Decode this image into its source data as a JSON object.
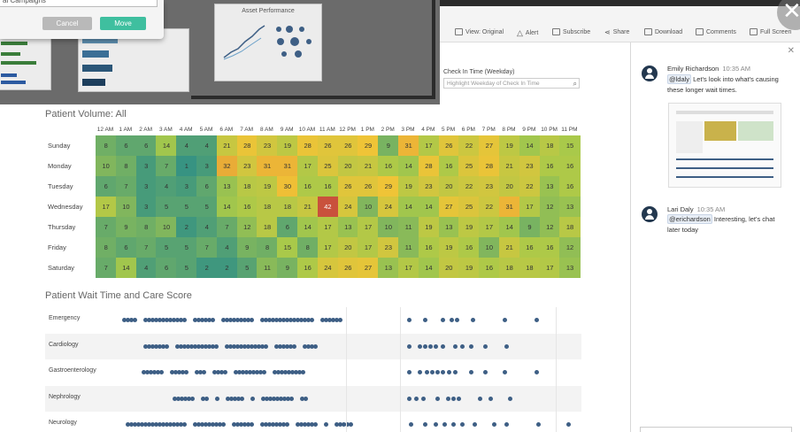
{
  "dialog": {
    "campaign_text": "al Campaigns",
    "cancel_label": "Cancel",
    "move_label": "Move"
  },
  "thumb": {
    "asset_title": "Asset Performance"
  },
  "toolbar": {
    "view_original": "View: Original",
    "alert": "Alert",
    "subscribe": "Subscribe",
    "share": "Share",
    "download": "Download",
    "comments": "Comments",
    "full_screen": "Full Screen"
  },
  "filter": {
    "label": "Check In Time (Weekday)",
    "placeholder": "Highlight Weekday of Check In Time"
  },
  "heatmap": {
    "title": "Patient Volume: All",
    "hours": [
      "12 AM",
      "1 AM",
      "2 AM",
      "3 AM",
      "4 AM",
      "5 AM",
      "6 AM",
      "7 AM",
      "8 AM",
      "9 AM",
      "10 AM",
      "11 AM",
      "12 PM",
      "1 PM",
      "2 PM",
      "3 PM",
      "4 PM",
      "5 PM",
      "6 PM",
      "7 PM",
      "8 PM",
      "9 PM",
      "10 PM",
      "11 PM"
    ],
    "days": [
      "Sunday",
      "Monday",
      "Tuesday",
      "Wednesday",
      "Thursday",
      "Friday",
      "Saturday"
    ],
    "values": [
      [
        8,
        6,
        6,
        14,
        4,
        4,
        21,
        28,
        23,
        19,
        28,
        26,
        26,
        29,
        9,
        31,
        17,
        26,
        22,
        27,
        19,
        14,
        18,
        15
      ],
      [
        10,
        8,
        3,
        7,
        1,
        3,
        32,
        23,
        31,
        31,
        17,
        25,
        20,
        21,
        16,
        14,
        28,
        16,
        25,
        28,
        21,
        23,
        16,
        16
      ],
      [
        6,
        7,
        3,
        4,
        3,
        6,
        13,
        18,
        19,
        30,
        16,
        16,
        26,
        26,
        29,
        19,
        23,
        20,
        22,
        23,
        20,
        22,
        13,
        16
      ],
      [
        17,
        10,
        3,
        5,
        5,
        5,
        14,
        16,
        18,
        18,
        21,
        42,
        24,
        10,
        24,
        14,
        14,
        27,
        25,
        22,
        31,
        17,
        12,
        13
      ],
      [
        7,
        9,
        8,
        10,
        2,
        4,
        7,
        12,
        18,
        6,
        14,
        17,
        13,
        17,
        10,
        11,
        19,
        13,
        19,
        17,
        14,
        9,
        12,
        18
      ],
      [
        8,
        6,
        7,
        5,
        5,
        7,
        4,
        9,
        8,
        15,
        8,
        17,
        20,
        17,
        23,
        11,
        16,
        19,
        16,
        10,
        21,
        16,
        16,
        12
      ],
      [
        7,
        14,
        4,
        6,
        5,
        2,
        2,
        5,
        11,
        9,
        16,
        24,
        26,
        27,
        13,
        17,
        14,
        20,
        19,
        16,
        18,
        18,
        17,
        13
      ]
    ]
  },
  "wait": {
    "title": "Patient Wait Time and Care Score",
    "departments": [
      "Emergency",
      "Cardiology",
      "Gastroenterology",
      "Nephrology",
      "Neurology"
    ]
  },
  "comments": [
    {
      "author": "Emily Richardson",
      "time": "10:35 AM",
      "mention": "@ldaly",
      "text_a": " Let's look into what's causing",
      "text_b": "these longer wait times."
    },
    {
      "author": "Lari Daly",
      "time": "10:35 AM",
      "mention": "@erichardson",
      "text_a": " Interesting, let's chat",
      "text_b": "later today"
    }
  ],
  "colors": {
    "low": "#2f8f86",
    "mid": "#a7c94a",
    "high": "#f1c436",
    "peak": "#c9513c",
    "dot": "#3e5f85",
    "accent": "#3fbf9f"
  }
}
